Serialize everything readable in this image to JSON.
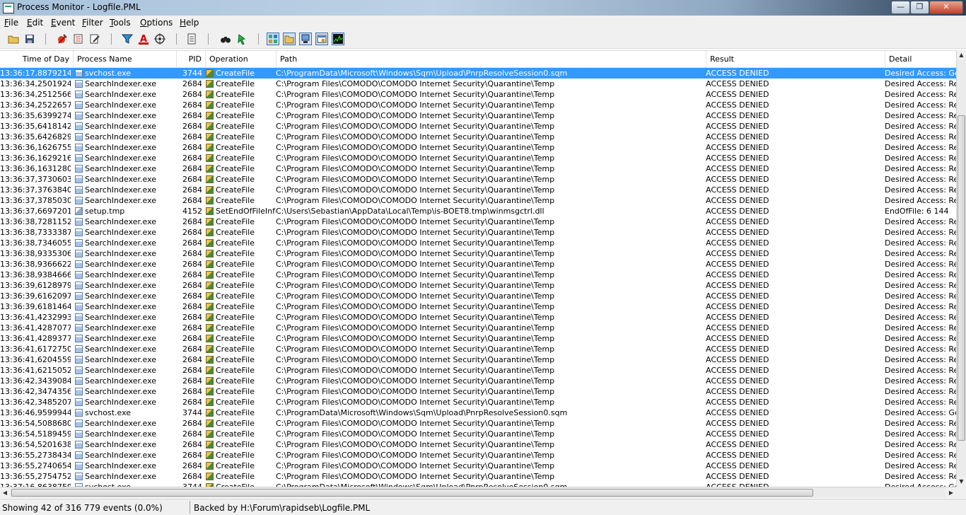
{
  "window": {
    "title": "Process Monitor - Logfile.PML",
    "minimize": "—",
    "maximize": "❐",
    "close": "✕"
  },
  "menu": [
    "File",
    "Edit",
    "Event",
    "Filter",
    "Tools",
    "Options",
    "Help"
  ],
  "toolbar": {
    "buttons": [
      "open-icon",
      "save-icon",
      "capture-icon",
      "autoscroll-icon",
      "clear-icon",
      "filter-icon",
      "highlight-icon",
      "include-process-icon",
      "process-tree-icon",
      "find-icon",
      "jump-icon",
      "registry-activity-icon",
      "file-activity-icon",
      "network-activity-icon",
      "process-activity-icon",
      "profiling-activity-icon"
    ],
    "active": [
      "registry-activity-icon",
      "file-activity-icon",
      "network-activity-icon",
      "process-activity-icon",
      "profiling-activity-icon"
    ]
  },
  "columns": {
    "time": "Time of Day",
    "process": "Process Name",
    "pid": "PID",
    "operation": "Operation",
    "path": "Path",
    "result": "Result",
    "detail": "Detail"
  },
  "colors": {
    "selection": "#3399ff"
  },
  "rows": [
    {
      "time": "13:36:17,8879214",
      "process": "svchost.exe",
      "pid": "3744",
      "op": "CreateFile",
      "path": "C:\\ProgramData\\Microsoft\\Windows\\Sqm\\Upload\\PnrpResolveSession0.sqm",
      "result": "ACCESS DENIED",
      "detail": "Desired Access: Generic Read/Write",
      "selected": true
    },
    {
      "time": "13:36:34,2501924",
      "process": "SearchIndexer.exe",
      "pid": "2684",
      "op": "CreateFile",
      "path": "C:\\Program Files\\COMODO\\COMODO Internet Security\\Quarantine\\Temp",
      "result": "ACCESS DENIED",
      "detail": "Desired Access: Read"
    },
    {
      "time": "13:36:34,2512566",
      "process": "SearchIndexer.exe",
      "pid": "2684",
      "op": "CreateFile",
      "path": "C:\\Program Files\\COMODO\\COMODO Internet Security\\Quarantine\\Temp",
      "result": "ACCESS DENIED",
      "detail": "Desired Access: Read"
    },
    {
      "time": "13:36:34,2522657",
      "process": "SearchIndexer.exe",
      "pid": "2684",
      "op": "CreateFile",
      "path": "C:\\Program Files\\COMODO\\COMODO Internet Security\\Quarantine\\Temp",
      "result": "ACCESS DENIED",
      "detail": "Desired Access: Read"
    },
    {
      "time": "13:36:35,6399274",
      "process": "SearchIndexer.exe",
      "pid": "2684",
      "op": "CreateFile",
      "path": "C:\\Program Files\\COMODO\\COMODO Internet Security\\Quarantine\\Temp",
      "result": "ACCESS DENIED",
      "detail": "Desired Access: Read"
    },
    {
      "time": "13:36:35,6418142",
      "process": "SearchIndexer.exe",
      "pid": "2684",
      "op": "CreateFile",
      "path": "C:\\Program Files\\COMODO\\COMODO Internet Security\\Quarantine\\Temp",
      "result": "ACCESS DENIED",
      "detail": "Desired Access: Read"
    },
    {
      "time": "13:36:35,6426829",
      "process": "SearchIndexer.exe",
      "pid": "2684",
      "op": "CreateFile",
      "path": "C:\\Program Files\\COMODO\\COMODO Internet Security\\Quarantine\\Temp",
      "result": "ACCESS DENIED",
      "detail": "Desired Access: Read"
    },
    {
      "time": "13:36:36,1626755",
      "process": "SearchIndexer.exe",
      "pid": "2684",
      "op": "CreateFile",
      "path": "C:\\Program Files\\COMODO\\COMODO Internet Security\\Quarantine\\Temp",
      "result": "ACCESS DENIED",
      "detail": "Desired Access: Read"
    },
    {
      "time": "13:36:36,1629216",
      "process": "SearchIndexer.exe",
      "pid": "2684",
      "op": "CreateFile",
      "path": "C:\\Program Files\\COMODO\\COMODO Internet Security\\Quarantine\\Temp",
      "result": "ACCESS DENIED",
      "detail": "Desired Access: Read"
    },
    {
      "time": "13:36:36,1631280",
      "process": "SearchIndexer.exe",
      "pid": "2684",
      "op": "CreateFile",
      "path": "C:\\Program Files\\COMODO\\COMODO Internet Security\\Quarantine\\Temp",
      "result": "ACCESS DENIED",
      "detail": "Desired Access: Read"
    },
    {
      "time": "13:36:37,3730603",
      "process": "SearchIndexer.exe",
      "pid": "2684",
      "op": "CreateFile",
      "path": "C:\\Program Files\\COMODO\\COMODO Internet Security\\Quarantine\\Temp",
      "result": "ACCESS DENIED",
      "detail": "Desired Access: Read"
    },
    {
      "time": "13:36:37,3763840",
      "process": "SearchIndexer.exe",
      "pid": "2684",
      "op": "CreateFile",
      "path": "C:\\Program Files\\COMODO\\COMODO Internet Security\\Quarantine\\Temp",
      "result": "ACCESS DENIED",
      "detail": "Desired Access: Read"
    },
    {
      "time": "13:36:37,3785030",
      "process": "SearchIndexer.exe",
      "pid": "2684",
      "op": "CreateFile",
      "path": "C:\\Program Files\\COMODO\\COMODO Internet Security\\Quarantine\\Temp",
      "result": "ACCESS DENIED",
      "detail": "Desired Access: Read"
    },
    {
      "time": "13:36:37,6697201",
      "process": "setup.tmp",
      "pid": "4152",
      "op": "SetEndOfFileInformationFile",
      "path": "C:\\Users\\Sebastian\\AppData\\Local\\Temp\\is-BOET8.tmp\\winmsgctrl.dll",
      "result": "ACCESS DENIED",
      "detail": "EndOfFile: 6 144"
    },
    {
      "time": "13:36:38,7281152",
      "process": "SearchIndexer.exe",
      "pid": "2684",
      "op": "CreateFile",
      "path": "C:\\Program Files\\COMODO\\COMODO Internet Security\\Quarantine\\Temp",
      "result": "ACCESS DENIED",
      "detail": "Desired Access: Read"
    },
    {
      "time": "13:36:38,7333387",
      "process": "SearchIndexer.exe",
      "pid": "2684",
      "op": "CreateFile",
      "path": "C:\\Program Files\\COMODO\\COMODO Internet Security\\Quarantine\\Temp",
      "result": "ACCESS DENIED",
      "detail": "Desired Access: Read"
    },
    {
      "time": "13:36:38,7346055",
      "process": "SearchIndexer.exe",
      "pid": "2684",
      "op": "CreateFile",
      "path": "C:\\Program Files\\COMODO\\COMODO Internet Security\\Quarantine\\Temp",
      "result": "ACCESS DENIED",
      "detail": "Desired Access: Read"
    },
    {
      "time": "13:36:38,9335306",
      "process": "SearchIndexer.exe",
      "pid": "2684",
      "op": "CreateFile",
      "path": "C:\\Program Files\\COMODO\\COMODO Internet Security\\Quarantine\\Temp",
      "result": "ACCESS DENIED",
      "detail": "Desired Access: Read"
    },
    {
      "time": "13:36:38,9366622",
      "process": "SearchIndexer.exe",
      "pid": "2684",
      "op": "CreateFile",
      "path": "C:\\Program Files\\COMODO\\COMODO Internet Security\\Quarantine\\Temp",
      "result": "ACCESS DENIED",
      "detail": "Desired Access: Read"
    },
    {
      "time": "13:36:38,9384666",
      "process": "SearchIndexer.exe",
      "pid": "2684",
      "op": "CreateFile",
      "path": "C:\\Program Files\\COMODO\\COMODO Internet Security\\Quarantine\\Temp",
      "result": "ACCESS DENIED",
      "detail": "Desired Access: Read"
    },
    {
      "time": "13:36:39,6128979",
      "process": "SearchIndexer.exe",
      "pid": "2684",
      "op": "CreateFile",
      "path": "C:\\Program Files\\COMODO\\COMODO Internet Security\\Quarantine\\Temp",
      "result": "ACCESS DENIED",
      "detail": "Desired Access: Read"
    },
    {
      "time": "13:36:39,6162097",
      "process": "SearchIndexer.exe",
      "pid": "2684",
      "op": "CreateFile",
      "path": "C:\\Program Files\\COMODO\\COMODO Internet Security\\Quarantine\\Temp",
      "result": "ACCESS DENIED",
      "detail": "Desired Access: Read"
    },
    {
      "time": "13:36:39,6181464",
      "process": "SearchIndexer.exe",
      "pid": "2684",
      "op": "CreateFile",
      "path": "C:\\Program Files\\COMODO\\COMODO Internet Security\\Quarantine\\Temp",
      "result": "ACCESS DENIED",
      "detail": "Desired Access: Read"
    },
    {
      "time": "13:36:41,4232993",
      "process": "SearchIndexer.exe",
      "pid": "2684",
      "op": "CreateFile",
      "path": "C:\\Program Files\\COMODO\\COMODO Internet Security\\Quarantine\\Temp",
      "result": "ACCESS DENIED",
      "detail": "Desired Access: Read"
    },
    {
      "time": "13:36:41,4287077",
      "process": "SearchIndexer.exe",
      "pid": "2684",
      "op": "CreateFile",
      "path": "C:\\Program Files\\COMODO\\COMODO Internet Security\\Quarantine\\Temp",
      "result": "ACCESS DENIED",
      "detail": "Desired Access: Read"
    },
    {
      "time": "13:36:41,4289377",
      "process": "SearchIndexer.exe",
      "pid": "2684",
      "op": "CreateFile",
      "path": "C:\\Program Files\\COMODO\\COMODO Internet Security\\Quarantine\\Temp",
      "result": "ACCESS DENIED",
      "detail": "Desired Access: Read"
    },
    {
      "time": "13:36:41,6172750",
      "process": "SearchIndexer.exe",
      "pid": "2684",
      "op": "CreateFile",
      "path": "C:\\Program Files\\COMODO\\COMODO Internet Security\\Quarantine\\Temp",
      "result": "ACCESS DENIED",
      "detail": "Desired Access: Read"
    },
    {
      "time": "13:36:41,6204559",
      "process": "SearchIndexer.exe",
      "pid": "2684",
      "op": "CreateFile",
      "path": "C:\\Program Files\\COMODO\\COMODO Internet Security\\Quarantine\\Temp",
      "result": "ACCESS DENIED",
      "detail": "Desired Access: Read"
    },
    {
      "time": "13:36:41,6215052",
      "process": "SearchIndexer.exe",
      "pid": "2684",
      "op": "CreateFile",
      "path": "C:\\Program Files\\COMODO\\COMODO Internet Security\\Quarantine\\Temp",
      "result": "ACCESS DENIED",
      "detail": "Desired Access: Read"
    },
    {
      "time": "13:36:42,3439084",
      "process": "SearchIndexer.exe",
      "pid": "2684",
      "op": "CreateFile",
      "path": "C:\\Program Files\\COMODO\\COMODO Internet Security\\Quarantine\\Temp",
      "result": "ACCESS DENIED",
      "detail": "Desired Access: Read"
    },
    {
      "time": "13:36:42,3474356",
      "process": "SearchIndexer.exe",
      "pid": "2684",
      "op": "CreateFile",
      "path": "C:\\Program Files\\COMODO\\COMODO Internet Security\\Quarantine\\Temp",
      "result": "ACCESS DENIED",
      "detail": "Desired Access: Read"
    },
    {
      "time": "13:36:42,3485207",
      "process": "SearchIndexer.exe",
      "pid": "2684",
      "op": "CreateFile",
      "path": "C:\\Program Files\\COMODO\\COMODO Internet Security\\Quarantine\\Temp",
      "result": "ACCESS DENIED",
      "detail": "Desired Access: Read"
    },
    {
      "time": "13:36:46,9599944",
      "process": "svchost.exe",
      "pid": "3744",
      "op": "CreateFile",
      "path": "C:\\ProgramData\\Microsoft\\Windows\\Sqm\\Upload\\PnrpResolveSession0.sqm",
      "result": "ACCESS DENIED",
      "detail": "Desired Access: Generic Read/Write"
    },
    {
      "time": "13:36:54,5088680",
      "process": "SearchIndexer.exe",
      "pid": "2684",
      "op": "CreateFile",
      "path": "C:\\Program Files\\COMODO\\COMODO Internet Security\\Quarantine\\Temp",
      "result": "ACCESS DENIED",
      "detail": "Desired Access: Read"
    },
    {
      "time": "13:36:54,5189459",
      "process": "SearchIndexer.exe",
      "pid": "2684",
      "op": "CreateFile",
      "path": "C:\\Program Files\\COMODO\\COMODO Internet Security\\Quarantine\\Temp",
      "result": "ACCESS DENIED",
      "detail": "Desired Access: Read"
    },
    {
      "time": "13:36:54,5201638",
      "process": "SearchIndexer.exe",
      "pid": "2684",
      "op": "CreateFile",
      "path": "C:\\Program Files\\COMODO\\COMODO Internet Security\\Quarantine\\Temp",
      "result": "ACCESS DENIED",
      "detail": "Desired Access: Read"
    },
    {
      "time": "13:36:55,2738434",
      "process": "SearchIndexer.exe",
      "pid": "2684",
      "op": "CreateFile",
      "path": "C:\\Program Files\\COMODO\\COMODO Internet Security\\Quarantine\\Temp",
      "result": "ACCESS DENIED",
      "detail": "Desired Access: Read"
    },
    {
      "time": "13:36:55,2740654",
      "process": "SearchIndexer.exe",
      "pid": "2684",
      "op": "CreateFile",
      "path": "C:\\Program Files\\COMODO\\COMODO Internet Security\\Quarantine\\Temp",
      "result": "ACCESS DENIED",
      "detail": "Desired Access: Read"
    },
    {
      "time": "13:36:55,2754752",
      "process": "SearchIndexer.exe",
      "pid": "2684",
      "op": "CreateFile",
      "path": "C:\\Program Files\\COMODO\\COMODO Internet Security\\Quarantine\\Temp",
      "result": "ACCESS DENIED",
      "detail": "Desired Access: Read"
    },
    {
      "time": "13:37:16,8638759",
      "process": "svchost.exe",
      "pid": "3744",
      "op": "CreateFile",
      "path": "C:\\ProgramData\\Microsoft\\Windows\\Sqm\\Upload\\PnrpResolveSession0.sqm",
      "result": "ACCESS DENIED",
      "detail": "Desired Access: Generic Read/Write"
    }
  ],
  "status": {
    "events": "Showing 42 of 316 779 events (0.0%)",
    "backing": "Backed by H:\\Forum\\rapidseb\\Logfile.PML"
  }
}
